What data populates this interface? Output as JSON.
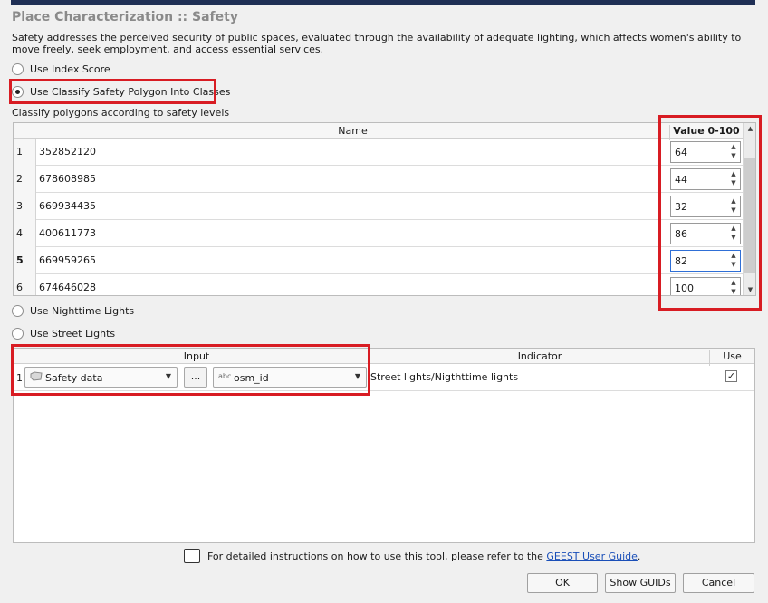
{
  "title": "Place Characterization :: Safety",
  "description": "Safety addresses the perceived security of public spaces, evaluated through the availability of adequate lighting, which affects women's ability to move freely, seek employment, and access essential services.",
  "options": {
    "index_score": "Use Index Score",
    "classify_polygon": "Use Classify Safety Polygon Into Classes",
    "nighttime_lights": "Use Nighttime Lights",
    "street_lights": "Use Street Lights"
  },
  "selected_option": "classify_polygon",
  "classify_label": "Classify polygons according to safety levels",
  "value_table": {
    "col_name": "Name",
    "col_value": "Value 0-100",
    "rows": [
      {
        "num": "1",
        "name": "352852120",
        "value": "64"
      },
      {
        "num": "2",
        "name": "678608985",
        "value": "44"
      },
      {
        "num": "3",
        "name": "669934435",
        "value": "32"
      },
      {
        "num": "4",
        "name": "400611773",
        "value": "86"
      },
      {
        "num": "5",
        "name": "669959265",
        "value": "82"
      },
      {
        "num": "6",
        "name": "674646028",
        "value": "100"
      }
    ]
  },
  "input_table": {
    "col_input": "Input",
    "col_indicator": "Indicator",
    "col_use": "Use",
    "rows": [
      {
        "num": "1",
        "layer": "Safety data",
        "ellipsis": "...",
        "field_type": "abc",
        "field": "osm_id",
        "indicator": "Street lights/Nigthttime lights",
        "use_checked": "✓"
      }
    ]
  },
  "footer": {
    "note_prefix": "For detailed instructions on how to use this tool, please refer to the",
    "link_text": "GEEST User Guide",
    "note_suffix": "."
  },
  "buttons": {
    "ok": "OK",
    "show_guids": "Show GUIDs",
    "cancel": "Cancel"
  },
  "icons": {
    "polygon_layer": "polygon-layer-icon",
    "speech": "speech-bubble-icon"
  },
  "colors": {
    "highlight_box": "#d81c23",
    "link": "#1a4fb8",
    "active_focus": "#2f6fd6"
  }
}
